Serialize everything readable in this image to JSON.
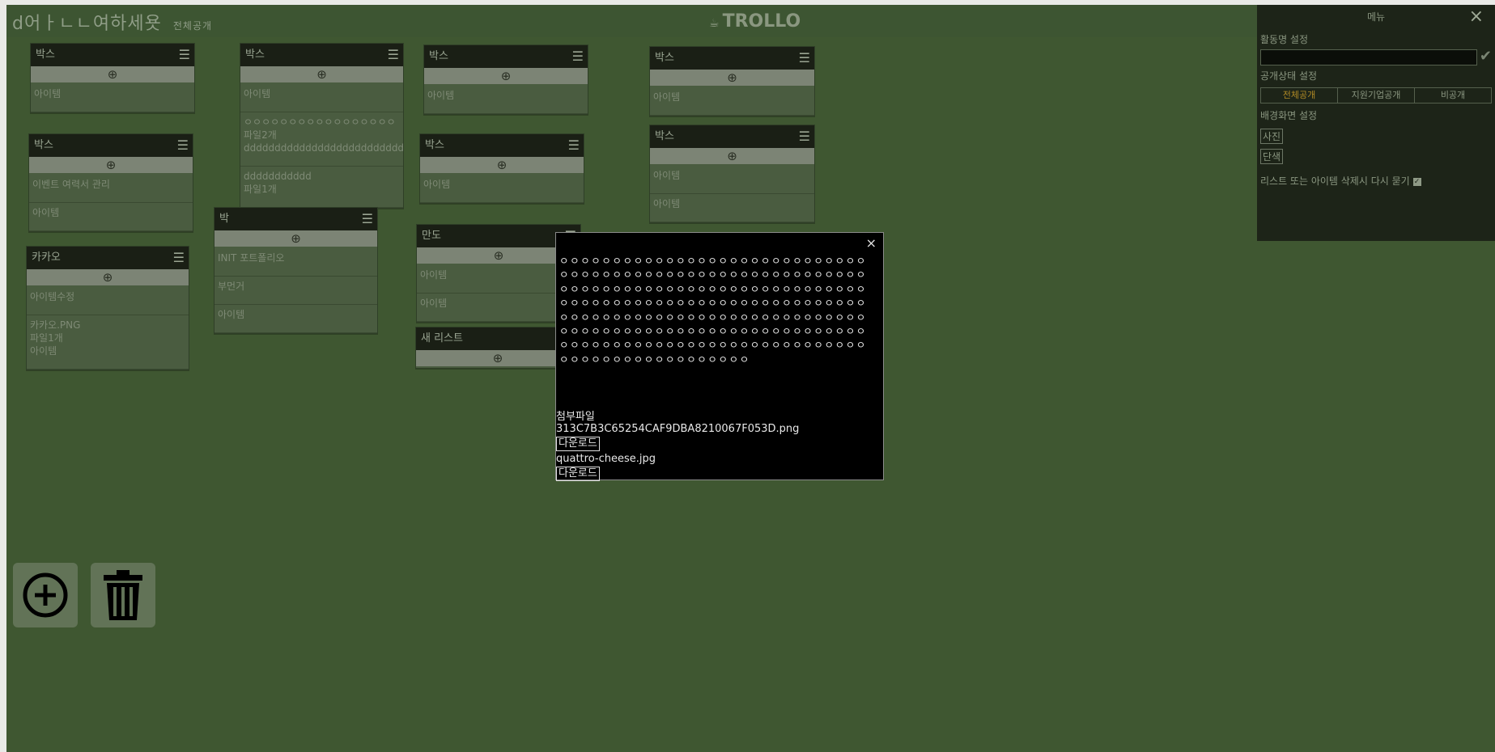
{
  "header": {
    "board_title": "d어ㅏㄴㄴ여하세욧",
    "board_visibility": "전체공개",
    "logo_icon": "☕",
    "logo_text": "TROLLO"
  },
  "lists": [
    {
      "title": "박스",
      "cards": [
        "아이템"
      ]
    },
    {
      "title": "박스",
      "cards": [
        "이벤트 여력서 관리",
        "아이템"
      ]
    },
    {
      "title": "카카오",
      "cards": [
        "아이템수정",
        "카카오.PNG\n파일1개\n아이템"
      ]
    },
    {
      "title": "박스",
      "cards": [
        "아이템",
        "ㅇㅇㅇㅇㅇㅇㅇㅇㅇㅇㅇㅇㅇㅇㅇㅇㅇ\n파일2개\ndddddddddddddddddddddddddddd",
        "ddddddddddd\n파일1개"
      ]
    },
    {
      "title": "박",
      "cards": [
        "INIT 포트폴리오",
        "부먼거",
        "아이템"
      ]
    },
    {
      "title": "박스",
      "cards": [
        "아이템"
      ]
    },
    {
      "title": "박스",
      "cards": [
        "아이템"
      ]
    },
    {
      "title": "만도",
      "cards": [
        "아이템",
        "아이템"
      ]
    },
    {
      "title": "새 리스트",
      "cards": []
    },
    {
      "title": "박스",
      "cards": [
        "아이템"
      ]
    },
    {
      "title": "박스",
      "cards": [
        "아이템",
        "아이템"
      ]
    }
  ],
  "side_menu": {
    "title": "메뉴",
    "close_icon": "×",
    "activity_name_label": "활동명 설정",
    "activity_name_value": "",
    "visibility_label": "공개상태 설정",
    "visibility_options": [
      "전체공개",
      "지원기업공개",
      "비공개"
    ],
    "visibility_selected": "전체공개",
    "background_label": "배경화면 설정",
    "background_photo": "사진",
    "background_solid": "단색",
    "confirm_delete_label": "리스트 또는 아이템 삭제시 다시 묻기",
    "confirm_delete_checked": true
  },
  "modal": {
    "close_icon": "×",
    "description": "ㅇㅇㅇㅇㅇㅇㅇㅇㅇㅇㅇㅇㅇㅇㅇㅇㅇㅇㅇㅇㅇㅇㅇㅇㅇㅇㅇㅇㅇㅇㅇㅇㅇㅇㅇㅇㅇㅇㅇㅇㅇㅇㅇㅇㅇㅇㅇㅇㅇㅇㅇㅇㅇㅇㅇㅇㅇㅇㅇㅇㅇㅇㅇㅇㅇㅇㅇㅇㅇㅇㅇㅇㅇㅇㅇㅇㅇㅇㅇㅇㅇㅇㅇㅇㅇㅇㅇㅇㅇㅇㅇㅇㅇㅇㅇㅇㅇㅇㅇㅇㅇㅇㅇㅇㅇㅇㅇㅇㅇㅇㅇㅇㅇㅇㅇㅇㅇㅇㅇㅇㅇㅇㅇㅇㅇㅇㅇㅇㅇㅇㅇㅇㅇㅇㅇㅇㅇㅇㅇㅇㅇㅇㅇㅇㅇㅇㅇㅇㅇㅇㅇㅇㅇㅇㅇㅇㅇㅇㅇㅇㅇㅇㅇㅇㅇㅇㅇㅇㅇㅇㅇㅇㅇㅇㅇㅇㅇㅇㅇㅇㅇㅇㅇㅇㅇㅇㅇㅇㅇㅇㅇㅇㅇㅇㅇㅇㅇㅇㅇㅇㅇㅇㅇㅇㅇㅇㅇㅇㅇㅇㅇㅇㅇㅇㅇㅇㅇㅇㅇㅇㅇ",
    "attachments_label": "첨부파일",
    "files": [
      {
        "name": "313C7B3C65254CAF9DBA8210067F053D.png",
        "download_label": "다운로드"
      },
      {
        "name": "quattro-cheese.jpg",
        "download_label": "다운로드"
      }
    ]
  },
  "icons": {
    "list_menu": "hamburger-menu-icon",
    "add_item": "plus-circle-icon",
    "add_list": "plus-circle-icon",
    "delete": "trash-icon",
    "close": "close-icon",
    "confirm": "check-icon"
  },
  "colors": {
    "board_background": "#3f5731",
    "list_header": "#1a1f15",
    "modal_background": "#000000",
    "visibility_active": "#b08a25"
  }
}
